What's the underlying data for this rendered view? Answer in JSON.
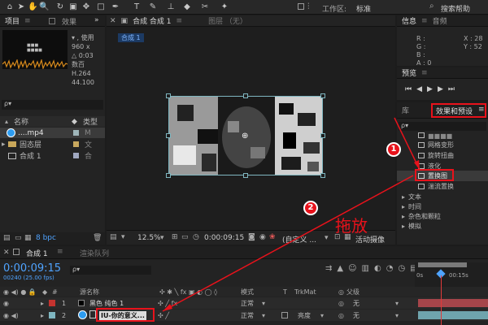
{
  "toolbar": {
    "icons": [
      "home-icon",
      "arrow-icon",
      "hand-icon",
      "zoom-icon",
      "rotate-icon",
      "camera-icon",
      "pan-behind-icon",
      "rect-tool-icon",
      "pen-icon",
      "text-icon",
      "brush-icon",
      "clone-icon",
      "eraser-icon",
      "roto-icon",
      "puppet-icon"
    ],
    "workspace_label": "工作区:",
    "workspace_value": "标准",
    "search_label": "搜索帮助"
  },
  "project_panel": {
    "tab_project": "项目",
    "tab_effects": "效果",
    "meta_line1": "▾ , 使用",
    "meta_line2": "960 x",
    "meta_line3": "△ 0:03",
    "meta_line4": "数百",
    "meta_line5": "H.264",
    "meta_line6": "44.100",
    "search_placeholder": "ρ▾",
    "col_name": "名称",
    "col_type": "类型",
    "items": [
      {
        "name": "....mp4",
        "type": "M"
      },
      {
        "name": "固态层",
        "type": "文"
      },
      {
        "name": "合成 1",
        "type": "合"
      }
    ],
    "bpc": "8 bpc"
  },
  "comp_panel": {
    "tab_comp": "合成 合成 1",
    "tab_layer": "图层 （无）",
    "sub_tab": "合成 1",
    "zoom": "12.5%",
    "time": "0:00:09:15",
    "view": "(自定义 ...",
    "active_camera": "活动摄像"
  },
  "info_panel": {
    "tab_info": "信息",
    "tab_audio": "音频",
    "r": "R :",
    "g": "G :",
    "b": "B :",
    "a": "A : 0",
    "x": "X : 28",
    "y": "Y : 52"
  },
  "preview_panel": {
    "tab": "预览"
  },
  "effects_panel": {
    "tab_library": "库",
    "tab_effects": "效果和预设",
    "menu_icon": "≡",
    "search_placeholder": "ρ▾",
    "items": [
      "网格变形",
      "旋转扭曲",
      "液化",
      "置换图",
      "湍流置换"
    ],
    "categories": [
      "文本",
      "时间",
      "杂色和颗粒",
      "模拟"
    ]
  },
  "annotations": {
    "badge1": "1",
    "badge2": "2",
    "drag_label": "拖放"
  },
  "timeline": {
    "tab_comp": "合成 1",
    "tab_render": "渲染队列",
    "timecode": "0:00:09:15",
    "frames": "00240 (25.00 fps)",
    "search_placeholder": "ρ▾",
    "col_num": "#",
    "col_source": "源名称",
    "col_mode": "模式",
    "col_t": "T",
    "col_trkmat": "TrkMat",
    "col_parent": "父级",
    "ruler": [
      "0s",
      "00:15s"
    ],
    "layers": [
      {
        "num": "1",
        "name": "黑色 纯色 1",
        "mode": "正常",
        "trkmat": "",
        "parent": "无",
        "color": "#c4332f"
      },
      {
        "num": "2",
        "name": "IU-你的意义...",
        "mode": "正常",
        "trkmat": "亮度",
        "parent": "无",
        "color": "#7fb6c0"
      }
    ]
  },
  "colors": {
    "accent": "#4fa3ff",
    "annotation": "#e8121b"
  }
}
